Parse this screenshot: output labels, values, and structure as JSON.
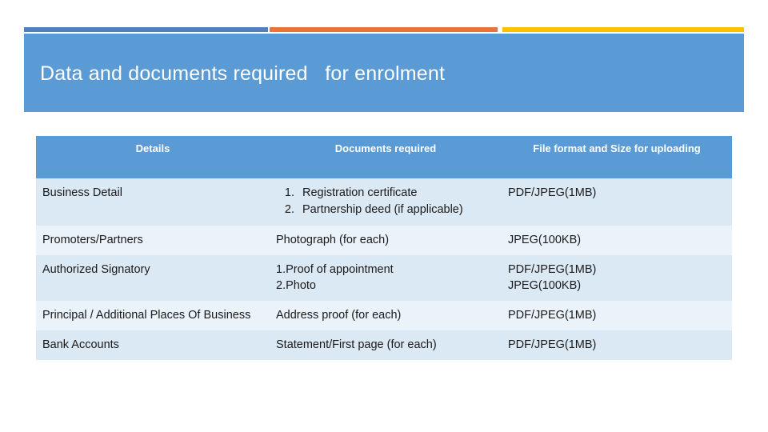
{
  "slide": {
    "title": "Data and documents required   for enrolment",
    "accent_colors": {
      "blue": "#4f81bd",
      "orange": "#e8743b",
      "yellow": "#ffc000",
      "band": "#5b9bd5"
    }
  },
  "table": {
    "headers": {
      "col1": "Details",
      "col2": "Documents required",
      "col3": "File format and Size for uploading"
    },
    "rows": [
      {
        "details": "Business Detail",
        "documents_list": [
          "Registration certificate",
          "Partnership deed (if applicable)"
        ],
        "documents_text": "",
        "format_line1": "PDF/JPEG(1MB)",
        "format_line2": ""
      },
      {
        "details": "Promoters/Partners",
        "documents_list": [],
        "documents_text": "Photograph (for each)",
        "format_line1": "JPEG(100KB)",
        "format_line2": ""
      },
      {
        "details": "Authorized Signatory",
        "documents_list": [],
        "documents_text": "1.Proof of appointment\n2.Photo",
        "format_line1": "PDF/JPEG(1MB)",
        "format_line2": "JPEG(100KB)"
      },
      {
        "details": "Principal / Additional Places Of Business",
        "documents_list": [],
        "documents_text": "Address proof (for each)",
        "format_line1": "PDF/JPEG(1MB)",
        "format_line2": ""
      },
      {
        "details": "Bank Accounts",
        "documents_list": [],
        "documents_text": "Statement/First page (for each)",
        "format_line1": "PDF/JPEG(1MB)",
        "format_line2": ""
      }
    ]
  }
}
